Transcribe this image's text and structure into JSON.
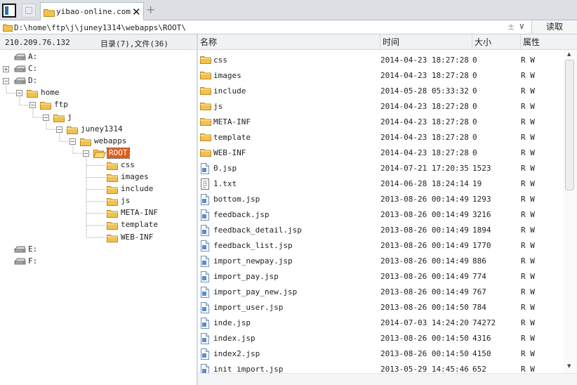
{
  "tabs": {
    "active_title": "yibao-online.com"
  },
  "address": {
    "path": "D:\\home\\ftp\\j\\juney1314\\webapps\\ROOT\\",
    "plusminus": "±",
    "dropdown": "∨",
    "read_label": "读取"
  },
  "info": {
    "server_ip": "210.209.76.132",
    "summary": "目录(7),文件(36)"
  },
  "columns": {
    "name": "名称",
    "time": "时间",
    "size": "大小",
    "attr": "属性"
  },
  "tree": [
    {
      "label": "A:",
      "type": "drive",
      "level": 0,
      "expander": ""
    },
    {
      "label": "C:",
      "type": "drive",
      "level": 0,
      "expander": "+"
    },
    {
      "label": "D:",
      "type": "drive",
      "level": 0,
      "expander": "-"
    },
    {
      "label": "home",
      "type": "folder",
      "level": 1,
      "expander": "-"
    },
    {
      "label": "ftp",
      "type": "folder",
      "level": 2,
      "expander": "-"
    },
    {
      "label": "j",
      "type": "folder",
      "level": 3,
      "expander": "-"
    },
    {
      "label": "juney1314",
      "type": "folder",
      "level": 4,
      "expander": "-"
    },
    {
      "label": "webapps",
      "type": "folder",
      "level": 5,
      "expander": "-"
    },
    {
      "label": "ROOT",
      "type": "folder-open",
      "level": 6,
      "expander": "-",
      "selected": true
    },
    {
      "label": "css",
      "type": "folder",
      "level": 7,
      "expander": ""
    },
    {
      "label": "images",
      "type": "folder",
      "level": 7,
      "expander": ""
    },
    {
      "label": "include",
      "type": "folder",
      "level": 7,
      "expander": ""
    },
    {
      "label": "js",
      "type": "folder",
      "level": 7,
      "expander": ""
    },
    {
      "label": "META-INF",
      "type": "folder",
      "level": 7,
      "expander": ""
    },
    {
      "label": "template",
      "type": "folder",
      "level": 7,
      "expander": ""
    },
    {
      "label": "WEB-INF",
      "type": "folder",
      "level": 7,
      "expander": ""
    },
    {
      "label": "E:",
      "type": "drive",
      "level": 0,
      "expander": ""
    },
    {
      "label": "F:",
      "type": "drive",
      "level": 0,
      "expander": ""
    }
  ],
  "files": [
    {
      "name": "css",
      "time": "2014-04-23 18:27:28",
      "size": "0",
      "attr": "R W",
      "type": "folder"
    },
    {
      "name": "images",
      "time": "2014-04-23 18:27:28",
      "size": "0",
      "attr": "R W",
      "type": "folder"
    },
    {
      "name": "include",
      "time": "2014-05-28 05:33:32",
      "size": "0",
      "attr": "R W",
      "type": "folder"
    },
    {
      "name": "js",
      "time": "2014-04-23 18:27:28",
      "size": "0",
      "attr": "R W",
      "type": "folder"
    },
    {
      "name": "META-INF",
      "time": "2014-04-23 18:27:28",
      "size": "0",
      "attr": "R W",
      "type": "folder"
    },
    {
      "name": "template",
      "time": "2014-04-23 18:27:28",
      "size": "0",
      "attr": "R W",
      "type": "folder"
    },
    {
      "name": "WEB-INF",
      "time": "2014-04-23 18:27:28",
      "size": "0",
      "attr": "R W",
      "type": "folder"
    },
    {
      "name": "0.jsp",
      "time": "2014-07-21 17:20:35",
      "size": "1523",
      "attr": "R W",
      "type": "file"
    },
    {
      "name": "1.txt",
      "time": "2014-06-28 18:24:14",
      "size": "19",
      "attr": "R W",
      "type": "text"
    },
    {
      "name": "bottom.jsp",
      "time": "2013-08-26 00:14:49",
      "size": "1293",
      "attr": "R W",
      "type": "file"
    },
    {
      "name": "feedback.jsp",
      "time": "2013-08-26 00:14:49",
      "size": "3216",
      "attr": "R W",
      "type": "file"
    },
    {
      "name": "feedback_detail.jsp",
      "time": "2013-08-26 00:14:49",
      "size": "1894",
      "attr": "R W",
      "type": "file"
    },
    {
      "name": "feedback_list.jsp",
      "time": "2013-08-26 00:14:49",
      "size": "1770",
      "attr": "R W",
      "type": "file"
    },
    {
      "name": "import_newpay.jsp",
      "time": "2013-08-26 00:14:49",
      "size": "886",
      "attr": "R W",
      "type": "file"
    },
    {
      "name": "import_pay.jsp",
      "time": "2013-08-26 00:14:49",
      "size": "774",
      "attr": "R W",
      "type": "file"
    },
    {
      "name": "import_pay_new.jsp",
      "time": "2013-08-26 00:14:49",
      "size": "767",
      "attr": "R W",
      "type": "file"
    },
    {
      "name": "import_user.jsp",
      "time": "2013-08-26 00:14:50",
      "size": "784",
      "attr": "R W",
      "type": "file"
    },
    {
      "name": "inde.jsp",
      "time": "2014-07-03 14:24:20",
      "size": "74272",
      "attr": "R W",
      "type": "file"
    },
    {
      "name": "index.jsp",
      "time": "2013-08-26 00:14:50",
      "size": "4316",
      "attr": "R W",
      "type": "file"
    },
    {
      "name": "index2.jsp",
      "time": "2013-08-26 00:14:50",
      "size": "4150",
      "attr": "R W",
      "type": "file"
    },
    {
      "name": "init_import.jsp",
      "time": "2013-05-29 14:45:46",
      "size": "652",
      "attr": "R W",
      "type": "file"
    }
  ],
  "scroll": {
    "position": 0.0
  },
  "colors": {
    "selection": "#e05c17",
    "folder": "#f2c14e",
    "accent": "#2a6fb8"
  },
  "icons": {
    "folder": "folder-icon",
    "folder_open": "folder-open-icon",
    "drive": "drive-icon",
    "file": "file-icon",
    "text": "text-file-icon"
  }
}
